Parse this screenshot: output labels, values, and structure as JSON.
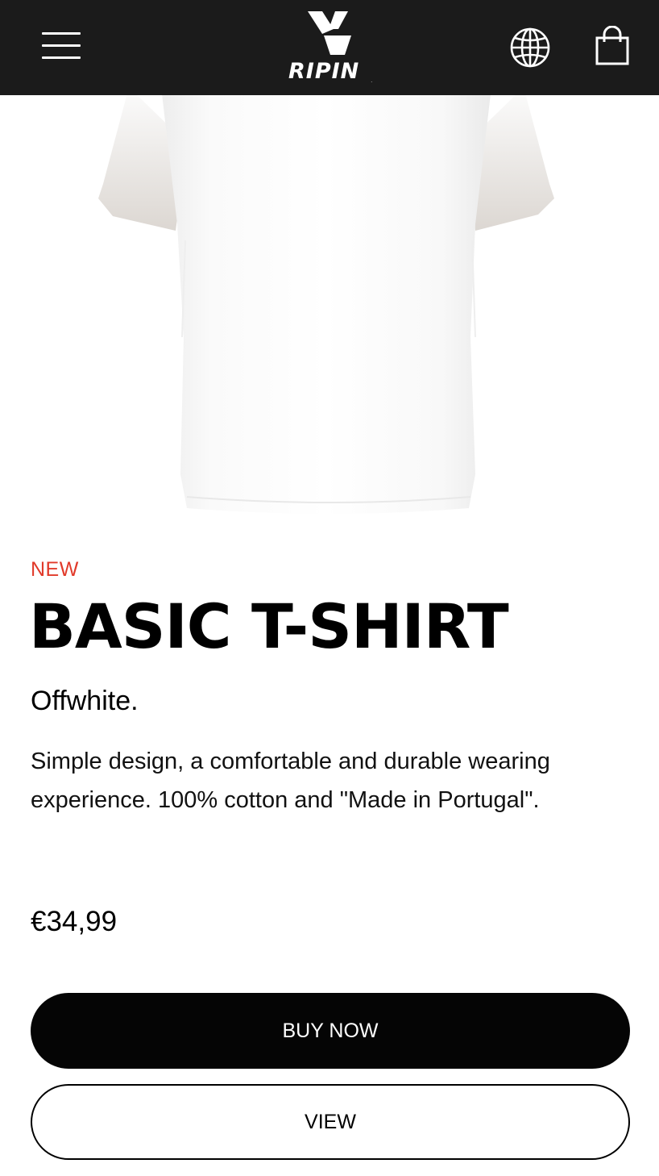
{
  "header": {
    "logo_text": "RIPIN",
    "logo_mark": "ripin-logo-mark",
    "menu_icon": "hamburger-menu-icon",
    "language_icon": "globe-icon",
    "cart_icon": "shopping-bag-icon",
    "background_color": "#1b1b1b"
  },
  "product": {
    "image_name": "white-t-shirt",
    "badge": "NEW",
    "title": "BASIC T-SHIRT",
    "color": "Offwhite.",
    "description": "Simple design, a comfortable and durable wearing experience. 100% cotton and \"Made in Portugal\".",
    "price": "€34,99",
    "badge_color": "#e13a2a"
  },
  "actions": {
    "buy_label": "BUY NOW",
    "view_label": "VIEW"
  }
}
